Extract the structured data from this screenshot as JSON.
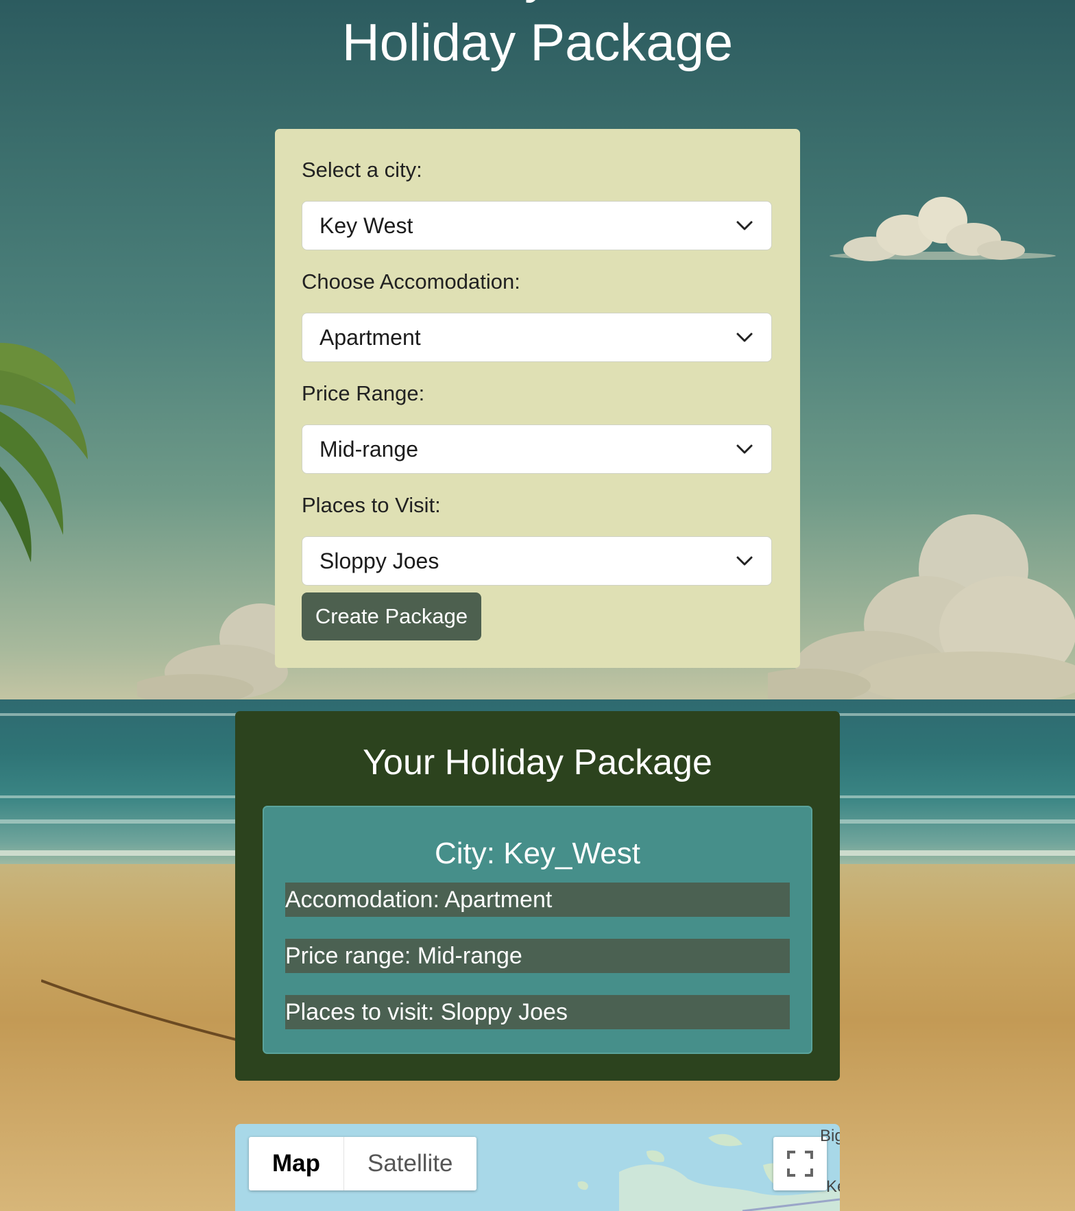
{
  "page": {
    "title": "Holiday Package"
  },
  "form": {
    "city_label": "Select a city:",
    "city_value": "Key West",
    "accommodation_label": "Choose Accomodation:",
    "accommodation_value": "Apartment",
    "price_label": "Price Range:",
    "price_value": "Mid-range",
    "places_label": "Places to Visit:",
    "places_value": "Sloppy Joes",
    "submit_label": "Create Package"
  },
  "result": {
    "title": "Your Holiday Package",
    "city": "City: Key_West",
    "accommodation": "Accomodation: Apartment",
    "price": "Price range: Mid-range",
    "places": "Places to visit: Sloppy Joes"
  },
  "map": {
    "map_label": "Map",
    "satellite_label": "Satellite",
    "place_label_1": "Big",
    "place_label_2": "Ke"
  },
  "colors": {
    "form_card_bg": "#dfe0b4",
    "button_bg": "#4d604f",
    "result_panel_bg": "#2c431e",
    "result_inner_bg": "#468f8a",
    "result_row_bg": "#4b6152"
  },
  "icons": {
    "select_arrow": "chevron-down-icon",
    "fullscreen": "fullscreen-icon"
  }
}
